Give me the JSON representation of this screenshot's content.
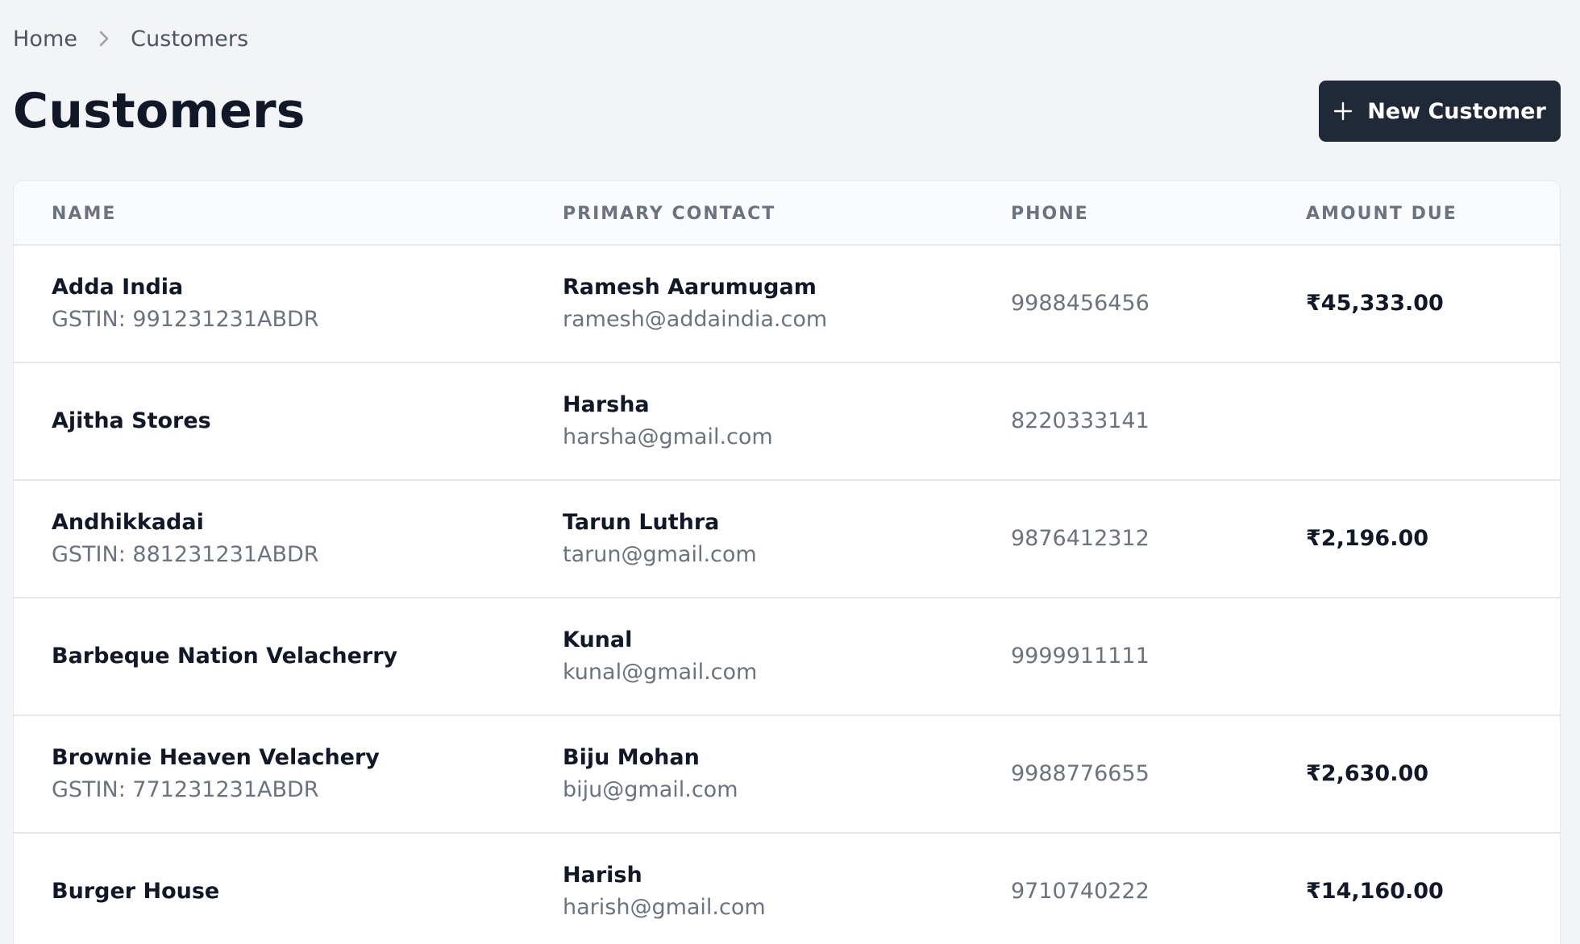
{
  "breadcrumb": {
    "items": [
      "Home",
      "Customers"
    ]
  },
  "header": {
    "title": "Customers",
    "new_button_label": "New Customer",
    "new_button_icon": "plus-icon"
  },
  "colors": {
    "background": "#f3f4f6",
    "button_bg": "#1f2937",
    "text_primary": "#111827",
    "text_secondary": "#6b7280"
  },
  "table": {
    "columns": [
      "Name",
      "Primary Contact",
      "Phone",
      "Amount Due"
    ],
    "rows": [
      {
        "name": "Adda India",
        "gstin": "GSTIN: 991231231ABDR",
        "contact_name": "Ramesh Aarumugam",
        "contact_email": "ramesh@addaindia.com",
        "phone": "9988456456",
        "amount_due": "₹45,333.00"
      },
      {
        "name": "Ajitha Stores",
        "gstin": "",
        "contact_name": "Harsha",
        "contact_email": "harsha@gmail.com",
        "phone": "8220333141",
        "amount_due": ""
      },
      {
        "name": "Andhikkadai",
        "gstin": "GSTIN: 881231231ABDR",
        "contact_name": "Tarun Luthra",
        "contact_email": "tarun@gmail.com",
        "phone": "9876412312",
        "amount_due": "₹2,196.00"
      },
      {
        "name": "Barbeque Nation Velacherry",
        "gstin": "",
        "contact_name": "Kunal",
        "contact_email": "kunal@gmail.com",
        "phone": "9999911111",
        "amount_due": ""
      },
      {
        "name": "Brownie Heaven Velachery",
        "gstin": "GSTIN: 771231231ABDR",
        "contact_name": "Biju Mohan",
        "contact_email": "biju@gmail.com",
        "phone": "9988776655",
        "amount_due": "₹2,630.00"
      },
      {
        "name": "Burger House",
        "gstin": "",
        "contact_name": "Harish",
        "contact_email": "harish@gmail.com",
        "phone": "9710740222",
        "amount_due": "₹14,160.00"
      }
    ]
  }
}
